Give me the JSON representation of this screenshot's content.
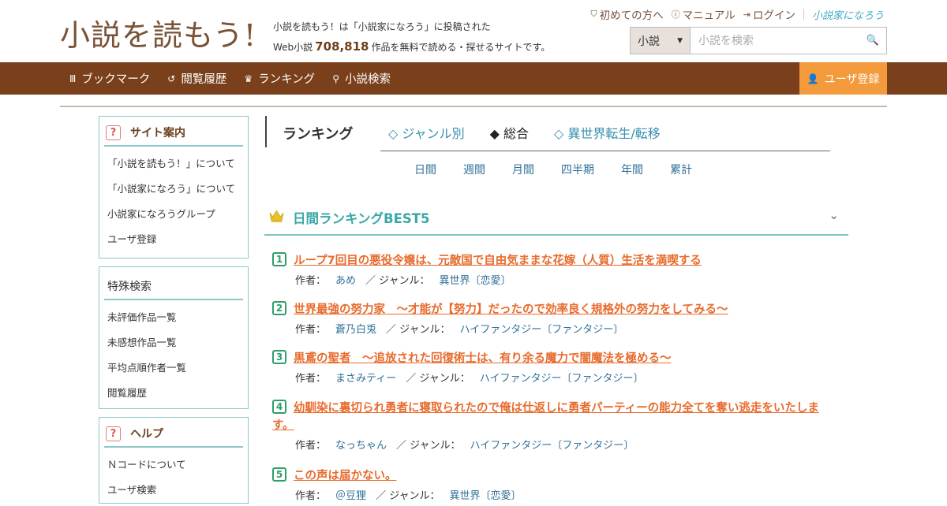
{
  "header": {
    "logo": "小説を読もう!",
    "tagline_line1": "小説を読もう！は「小説家になろう」に投稿された",
    "tagline_prefix": "Web小説",
    "novel_count": "708,818",
    "tagline_suffix": "作品を無料で読める・探せるサイトです。",
    "links": {
      "beginner": "初めての方へ",
      "manual": "マニュアル",
      "login": "ログイン",
      "brand": "小説家になろう"
    },
    "search": {
      "select_value": "小説",
      "placeholder": "小説を検索"
    }
  },
  "nav": {
    "items": [
      "ブックマーク",
      "閲覧履歴",
      "ランキング",
      "小説検索"
    ],
    "register": "ユーザ登録"
  },
  "sidebar": {
    "site_guide": {
      "title": "サイト案内",
      "items": [
        "「小説を読もう！」について",
        "「小説家になろう」について",
        "小説家になろうグループ",
        "ユーザ登録"
      ]
    },
    "special_search": {
      "title": "特殊検索",
      "items": [
        "未評価作品一覧",
        "未感想作品一覧",
        "平均点順作者一覧",
        "閲覧履歴"
      ]
    },
    "help": {
      "title": "ヘルプ",
      "items": [
        "Ｎコードについて",
        "ユーザ検索"
      ]
    }
  },
  "main": {
    "ranking_title": "ランキング",
    "tabs": [
      "◇ ジャンル別",
      "◆ 総合",
      "◇ 異世界転生/転移"
    ],
    "periods": [
      "日間",
      "週間",
      "月間",
      "四半期",
      "年間",
      "累計"
    ],
    "daily_title": "日間ランキングBEST5",
    "author_label": "作者：",
    "genre_label": "／ ジャンル：",
    "entries": [
      {
        "rank": "1",
        "title": "ループ7回目の悪役令嬢は、元敵国で自由気ままな花嫁（人質）生活を満喫する",
        "author": "あめ",
        "genre": "異世界〔恋愛〕"
      },
      {
        "rank": "2",
        "title": "世界最強の努力家　～才能が【努力】だったので効率良く規格外の努力をしてみる～",
        "author": "蒼乃白兎",
        "genre": "ハイファンタジー〔ファンタジー〕"
      },
      {
        "rank": "3",
        "title": "黒鳶の聖者　～追放された回復術士は、有り余る魔力で闇魔法を極める～",
        "author": "まさみティー",
        "genre": "ハイファンタジー〔ファンタジー〕"
      },
      {
        "rank": "4",
        "title": "幼馴染に裏切られ勇者に寝取られたので俺は仕返しに勇者パーティーの能力全てを奪い逃走をいたします。",
        "author": "なっちゃん",
        "genre": "ハイファンタジー〔ファンタジー〕"
      },
      {
        "rank": "5",
        "title": "この声は届かない。",
        "author": "＠豆狸",
        "genre": "異世界〔恋愛〕"
      }
    ]
  },
  "colors": {
    "brand_brown": "#7a401c",
    "accent_orange": "#f39a3c",
    "title_orange": "#e86b2d",
    "teal": "#3aa7a7",
    "link_blue": "#2f6f99"
  }
}
